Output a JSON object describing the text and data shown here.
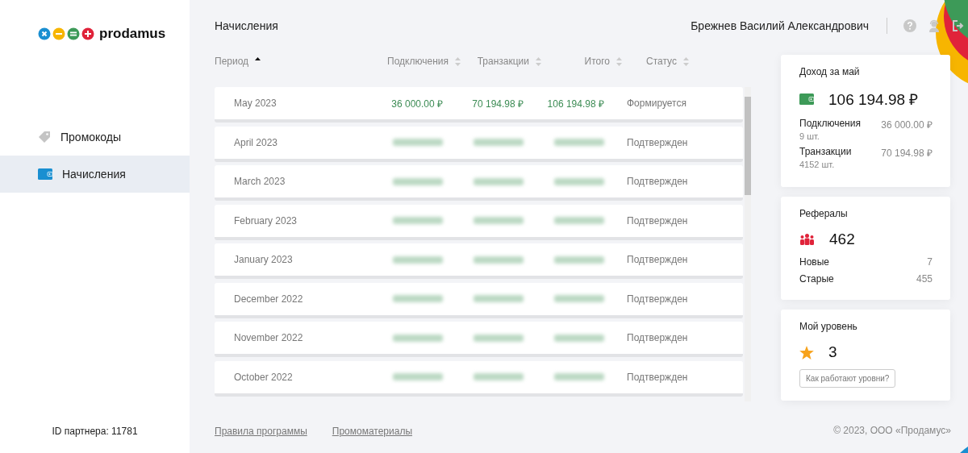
{
  "sidebar": {
    "logo_text": "prodamus",
    "items": [
      {
        "label": "Промокоды",
        "selected": false
      },
      {
        "label": "Начисления",
        "selected": true
      }
    ],
    "partner_id": "ID партнера: 11781"
  },
  "header": {
    "title": "Начисления",
    "user_name": "Брежнев Василий Александрович"
  },
  "table": {
    "columns": [
      {
        "label": "Период",
        "sorted": true
      },
      {
        "label": "Подключения",
        "sorted": false
      },
      {
        "label": "Транзакции",
        "sorted": false
      },
      {
        "label": "Итого",
        "sorted": false
      },
      {
        "label": "Статус",
        "sorted": false
      }
    ],
    "rows": [
      {
        "period": "May 2023",
        "kind": "visible",
        "connections": "36 000.00 ₽",
        "transactions": "70 194.98 ₽",
        "total": "106 194.98 ₽",
        "status": "Формируется"
      },
      {
        "period": "April 2023",
        "kind": "blurred",
        "status": "Подтвержден"
      },
      {
        "period": "March 2023",
        "kind": "blurred",
        "status": "Подтвержден"
      },
      {
        "period": "February 2023",
        "kind": "blurred",
        "status": "Подтвержден"
      },
      {
        "period": "January 2023",
        "kind": "blurred",
        "status": "Подтвержден"
      },
      {
        "period": "December 2022",
        "kind": "blurred",
        "status": "Подтвержден"
      },
      {
        "period": "November 2022",
        "kind": "blurred",
        "status": "Подтвержден"
      },
      {
        "period": "October 2022",
        "kind": "blurred",
        "status": "Подтвержден"
      }
    ]
  },
  "income_card": {
    "title": "Доход за май",
    "amount": "106 194.98 ₽",
    "lines": [
      {
        "label": "Подключения",
        "value": "36 000.00 ₽",
        "count": "9 шт."
      },
      {
        "label": "Транзакции",
        "value": "70 194.98 ₽",
        "count": "4152 шт."
      }
    ]
  },
  "referrals_card": {
    "title": "Рефералы",
    "count": "462",
    "lines": [
      {
        "label": "Новые",
        "value": "7"
      },
      {
        "label": "Старые",
        "value": "455"
      }
    ]
  },
  "level_card": {
    "title": "Мой уровень",
    "level": "3",
    "button": "Как работают уровни?"
  },
  "footer": {
    "links": [
      "Правила программы",
      "Промоматериалы"
    ],
    "copyright": "© 2023, ООО «Продамус»"
  }
}
